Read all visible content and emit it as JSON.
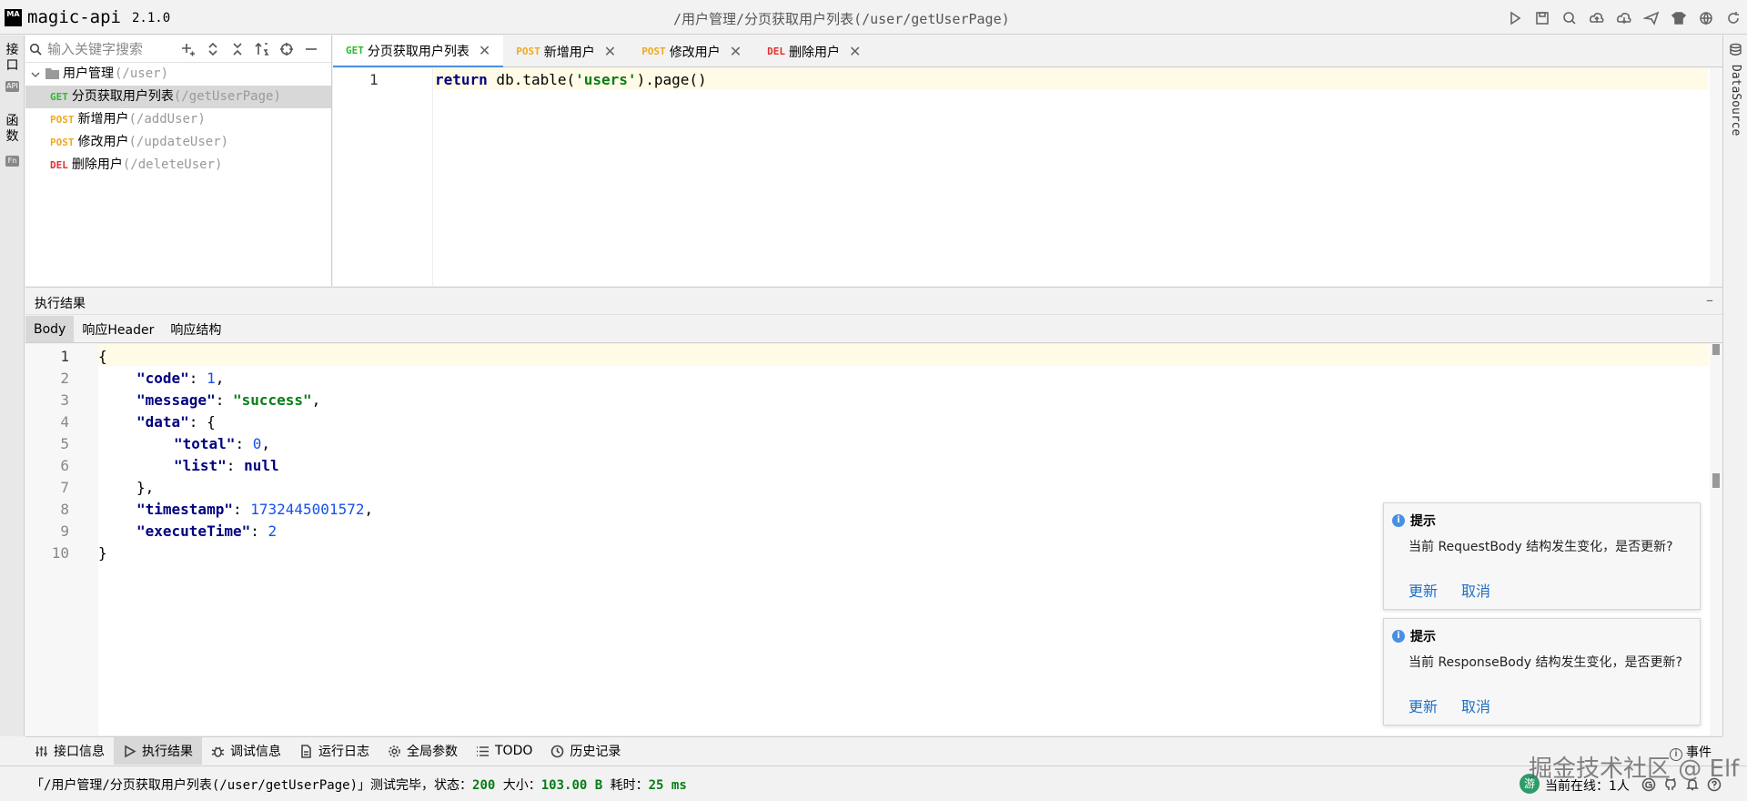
{
  "app": {
    "logo": "MA",
    "name": "magic-api",
    "version": "2.1.0",
    "window_title": "/用户管理/分页获取用户列表(/user/getUserPage)"
  },
  "title_icons": [
    "run-icon",
    "save-icon",
    "search-icon",
    "upload-icon",
    "download-icon",
    "send-icon",
    "skin-icon",
    "globe-icon",
    "refresh-icon"
  ],
  "leftbar": {
    "api_tab": "接口",
    "api_badge": "API",
    "func_tab": "函数",
    "func_badge": "Fn"
  },
  "rightbar": {
    "datasource": "DataSource"
  },
  "tree": {
    "search_placeholder": "输入关键字搜索",
    "group": {
      "label": "用户管理",
      "path": "(/user)"
    },
    "items": [
      {
        "method": "GET",
        "label": "分页获取用户列表",
        "path": "(/getUserPage)"
      },
      {
        "method": "POST",
        "label": "新增用户",
        "path": "(/addUser)"
      },
      {
        "method": "POST",
        "label": "修改用户",
        "path": "(/updateUser)"
      },
      {
        "method": "DEL",
        "label": "删除用户",
        "path": "(/deleteUser)"
      }
    ]
  },
  "tabs": [
    {
      "method": "GET",
      "label": "分页获取用户列表"
    },
    {
      "method": "POST",
      "label": "新增用户"
    },
    {
      "method": "POST",
      "label": "修改用户"
    },
    {
      "method": "DEL",
      "label": "删除用户"
    }
  ],
  "editor": {
    "line": "1",
    "kw": "return",
    "pre": " db.table(",
    "str": "'users'",
    "post": ").page()"
  },
  "result": {
    "title": "执行结果",
    "tabs": [
      "Body",
      "响应Header",
      "响应结构"
    ],
    "line_numbers": [
      "1",
      "2",
      "3",
      "4",
      "5",
      "6",
      "7",
      "8",
      "9",
      "10"
    ],
    "json": {
      "open": "{",
      "k_code": "\"code\"",
      "v_code": "1",
      "k_message": "\"message\"",
      "v_message": "\"success\"",
      "k_data": "\"data\"",
      "data_open": "{",
      "k_total": "\"total\"",
      "v_total": "0",
      "k_list": "\"list\"",
      "v_list": "null",
      "data_close": "},",
      "k_timestamp": "\"timestamp\"",
      "v_timestamp": "1732445001572",
      "k_execute": "\"executeTime\"",
      "v_execute": "2",
      "close": "}"
    }
  },
  "notifications": [
    {
      "title": "提示",
      "body": "当前 RequestBody 结构发生变化，是否更新?",
      "update": "更新",
      "cancel": "取消"
    },
    {
      "title": "提示",
      "body": "当前 ResponseBody 结构发生变化，是否更新?",
      "update": "更新",
      "cancel": "取消"
    }
  ],
  "bottom_tabs": [
    "接口信息",
    "执行结果",
    "调试信息",
    "运行日志",
    "全局参数",
    "TODO",
    "历史记录"
  ],
  "events_label": "事件",
  "status": {
    "prefix": "「/用户管理/分页获取用户列表(/user/getUserPage)」测试完毕，状态：",
    "status_code": "200",
    "size_label": " 大小：",
    "size": "103.00 B",
    "time_label": " 耗时：",
    "time": "25 ms"
  },
  "online": {
    "avatar": "游",
    "label": "当前在线：1人"
  },
  "watermark": "掘金技术社区 @ Elf"
}
